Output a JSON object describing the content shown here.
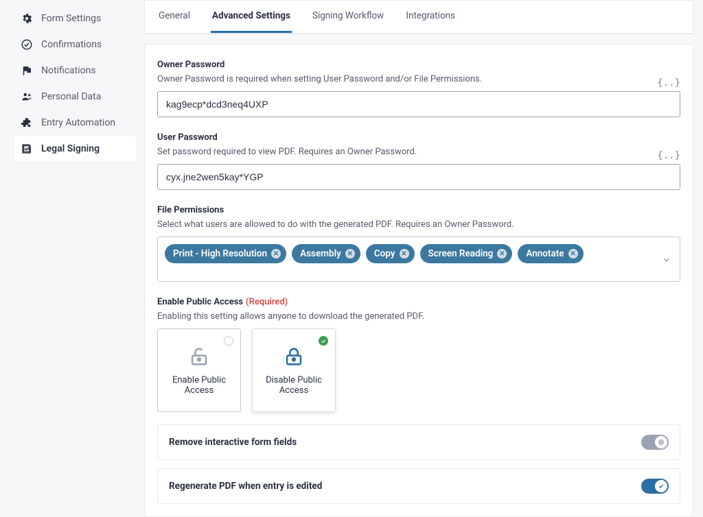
{
  "sidebar": {
    "items": [
      {
        "label": "Form Settings",
        "icon": "gear"
      },
      {
        "label": "Confirmations",
        "icon": "check-circle"
      },
      {
        "label": "Notifications",
        "icon": "flag"
      },
      {
        "label": "Personal Data",
        "icon": "users"
      },
      {
        "label": "Entry Automation",
        "icon": "puzzle"
      },
      {
        "label": "Legal Signing",
        "icon": "signature"
      }
    ],
    "active_index": 5
  },
  "tabs": {
    "items": [
      "General",
      "Advanced Settings",
      "Signing Workflow",
      "Integrations"
    ],
    "active_index": 1
  },
  "fields": {
    "owner_password": {
      "label": "Owner Password",
      "desc": "Owner Password is required when setting User Password and/or File Permissions.",
      "value": "kag9ecp*dcd3neq4UXP"
    },
    "user_password": {
      "label": "User Password",
      "desc": "Set password required to view PDF. Requires an Owner Password.",
      "value": "cyx.jne2wen5kay*YGP"
    },
    "file_permissions": {
      "label": "File Permissions",
      "desc": "Select what users are allowed to do with the generated PDF. Requires an Owner Password.",
      "values": [
        "Print - High Resolution",
        "Assembly",
        "Copy",
        "Screen Reading",
        "Annotate"
      ]
    },
    "public_access": {
      "label": "Enable Public Access",
      "req": "(Required)",
      "desc": "Enabling this setting allows anyone to download the generated PDF.",
      "options": [
        "Enable Public Access",
        "Disable Public Access"
      ],
      "selected_index": 1
    },
    "remove_fields": {
      "label": "Remove interactive form fields",
      "on": false
    },
    "regenerate": {
      "label": "Regenerate PDF when entry is edited",
      "on": true
    }
  }
}
